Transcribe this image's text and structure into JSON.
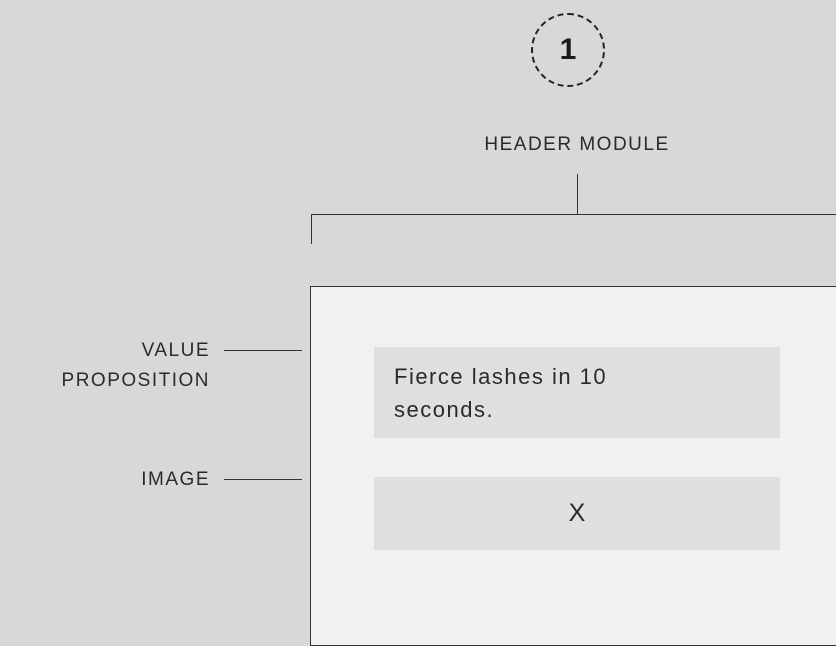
{
  "step": {
    "number": "1"
  },
  "module": {
    "title": "HEADER MODULE"
  },
  "callouts": {
    "value_proposition": "VALUE PROPOSITION",
    "image": "IMAGE"
  },
  "content": {
    "value_text": "Fierce lashes in 10 seconds.",
    "image_placeholder": "X"
  },
  "colors": {
    "background": "#d8d8d8",
    "panel": "#f1f1f1",
    "content_box": "#dfdfdf",
    "lines": "#333333"
  }
}
